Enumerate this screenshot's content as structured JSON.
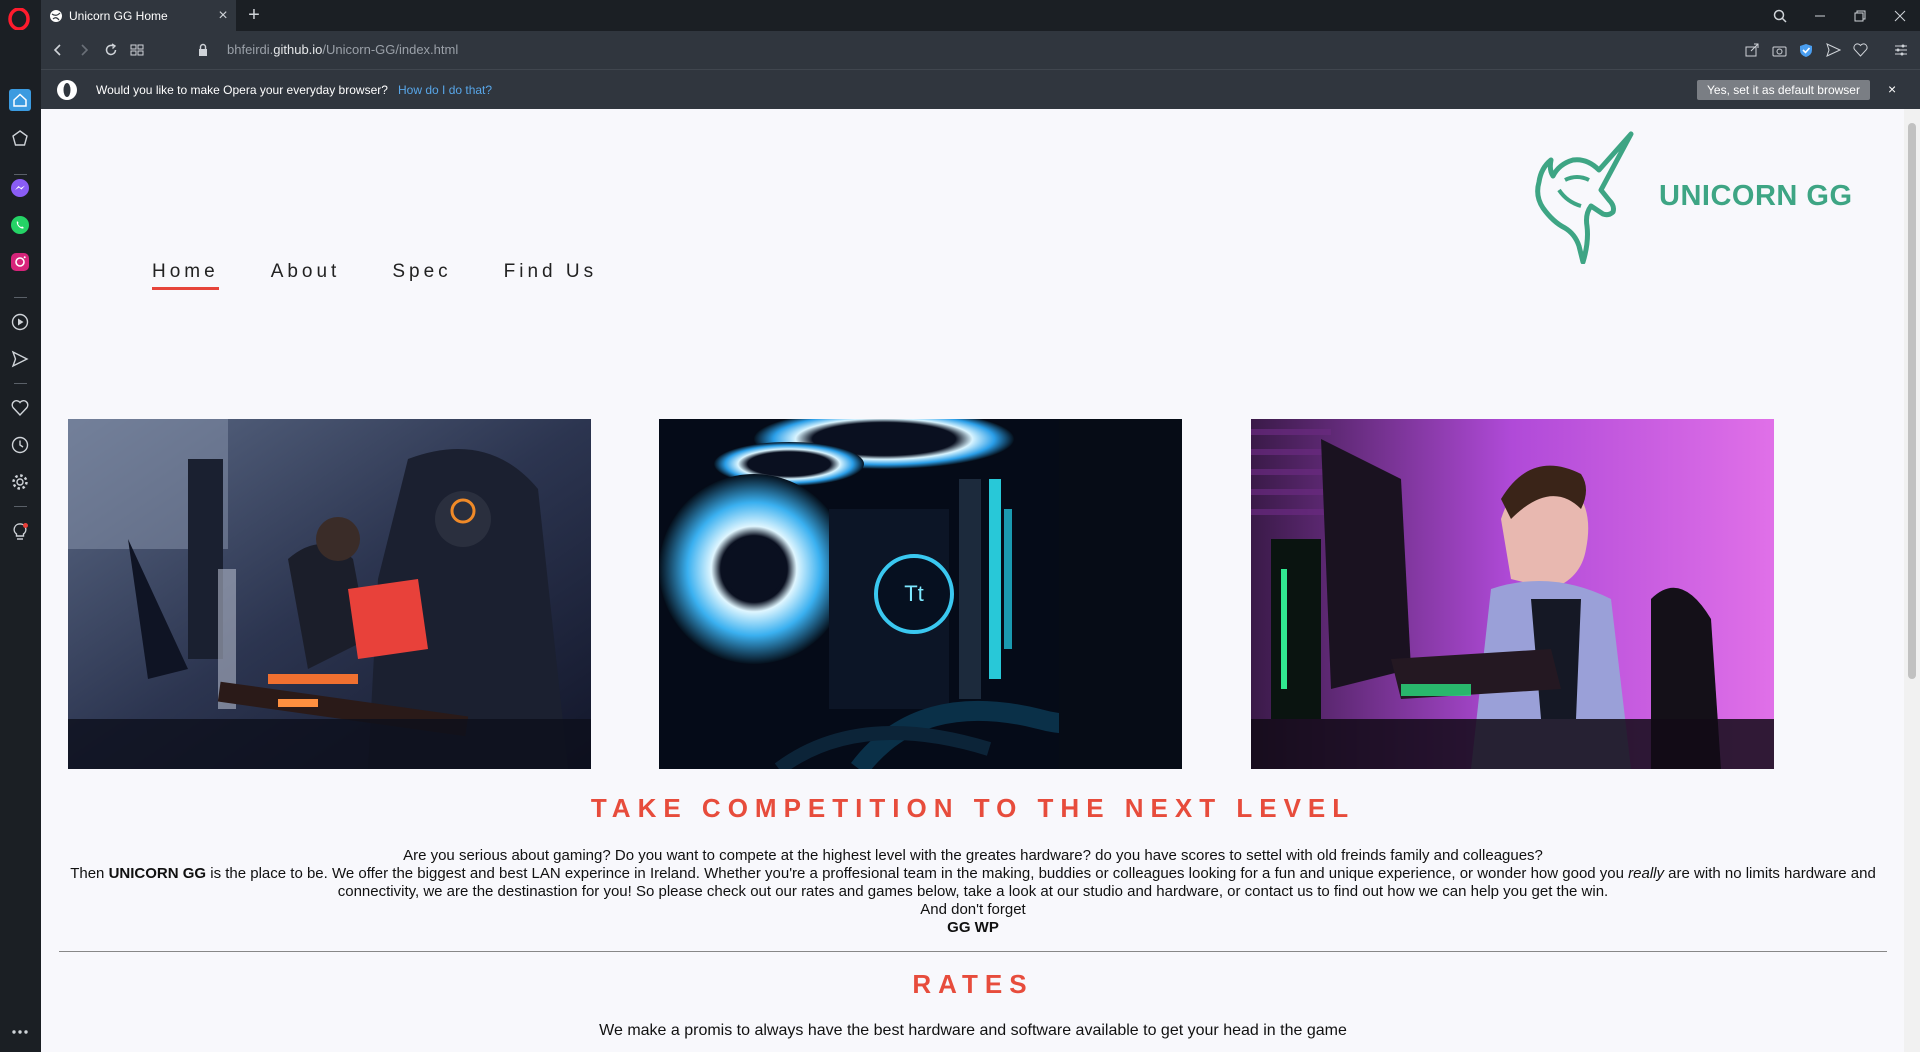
{
  "browser": {
    "tab_title": "Unicorn GG Home",
    "url_prefix": "bhfeirdi.",
    "url_domain": "github.io",
    "url_path": "/Unicorn-GG/index.html"
  },
  "infobar": {
    "message": "Would you like to make Opera your everyday browser?",
    "link": "How do I do that?",
    "button": "Yes, set it as default browser",
    "close": "×"
  },
  "site": {
    "brand": "UNICORN GG",
    "nav": [
      {
        "label": "Home",
        "active": true
      },
      {
        "label": "About",
        "active": false
      },
      {
        "label": "Spec",
        "active": false
      },
      {
        "label": "Find Us",
        "active": false
      }
    ],
    "headline": "TAKE COMPETITION TO THE NEXT LEVEL",
    "intro_line1": "Are you serious about gaming? Do you want to compete at the highest level with the greates hardware? do you have scores to settel with old freinds family and colleagues?",
    "intro_then": "Then ",
    "intro_brand": "UNICORN GG",
    "intro_mid": " is the place to be. We offer the biggest and best LAN experince in Ireland. Whether you're a proffesional team in the making, buddies or colleagues looking for a fun and unique experience, or wonder how good you ",
    "intro_really": "really",
    "intro_end": " are with no limits hardware and connectivity, we are the destinastion for you! So please check out our rates and games below, take a look at our studio and hardware, or contact us to find out how we can help you get the win.",
    "intro_forget": "And don't forget",
    "intro_gg": "GG WP",
    "rates_heading": "RATES",
    "rates_text": "We make a promis to always have the best hardware and software available to get your head in the game"
  },
  "colors": {
    "accent_red": "#e74c3c",
    "brand_green": "#3ea584",
    "chrome_dark": "#1b1f24",
    "chrome_mid": "#30363e"
  }
}
